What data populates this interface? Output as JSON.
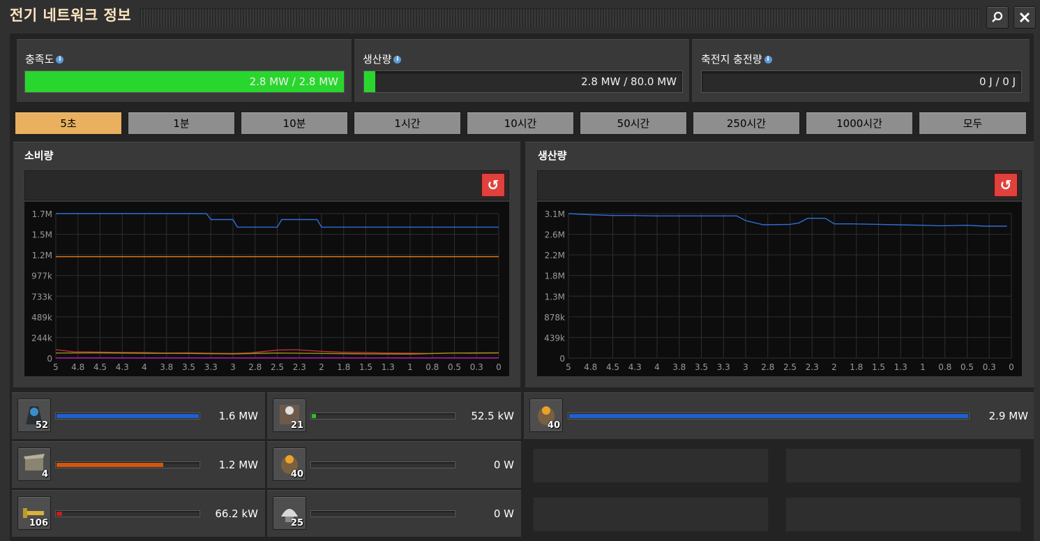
{
  "window": {
    "title": "전기 네트워크 정보",
    "search_icon": "magnifier-icon",
    "close_icon": "close-icon"
  },
  "stats": {
    "satisfaction": {
      "label": "충족도",
      "value_text": "2.8 MW / 2.8 MW",
      "fill_fraction": 1.0,
      "color": "#29d62e"
    },
    "production": {
      "label": "생산량",
      "value_text": "2.8 MW / 80.0 MW",
      "fill_fraction": 0.035,
      "color": "#29d62e"
    },
    "accumulator": {
      "label": "축전지 충전량",
      "value_text": "0 J / 0 J",
      "fill_fraction": 0
    }
  },
  "tabs": [
    {
      "label": "5초",
      "active": true
    },
    {
      "label": "1분",
      "active": false
    },
    {
      "label": "10분",
      "active": false
    },
    {
      "label": "1시간",
      "active": false
    },
    {
      "label": "10시간",
      "active": false
    },
    {
      "label": "50시간",
      "active": false
    },
    {
      "label": "250시간",
      "active": false
    },
    {
      "label": "1000시간",
      "active": false
    },
    {
      "label": "모두",
      "active": false
    }
  ],
  "chart_data": [
    {
      "type": "line",
      "title": "소비량",
      "grid": true,
      "xlim": [
        5,
        0
      ],
      "x_ticks": [
        "5",
        "4.8",
        "4.5",
        "4.3",
        "4",
        "3.8",
        "3.5",
        "3.3",
        "3",
        "2.8",
        "2.5",
        "2.3",
        "2",
        "1.8",
        "1.5",
        "1.3",
        "1",
        "0.8",
        "0.5",
        "0.3",
        "0"
      ],
      "y_ticks": [
        "1.7M",
        "1.5M",
        "1.2M",
        "977k",
        "733k",
        "489k",
        "244k",
        "0"
      ],
      "ylim": [
        0,
        1710000
      ],
      "series": [
        {
          "color": "#2f6fd8",
          "x": [
            5,
            3.3,
            3.25,
            3,
            2.95,
            2.5,
            2.45,
            2.05,
            2,
            0
          ],
          "y": [
            1710000,
            1710000,
            1640000,
            1640000,
            1550000,
            1550000,
            1640000,
            1640000,
            1550000,
            1550000
          ]
        },
        {
          "color": "#e07b1c",
          "x": [
            5,
            0
          ],
          "y": [
            1200000,
            1200000
          ]
        },
        {
          "color": "#c23030",
          "x": [
            5,
            4.8,
            4.5,
            4.3,
            4,
            3.8,
            3.5,
            3.3,
            3,
            2.8,
            2.5,
            2.3,
            2,
            1.8,
            1.5,
            1.3,
            1,
            0.8,
            0.5,
            0.3,
            0
          ],
          "y": [
            100000,
            75000,
            70000,
            68000,
            65000,
            60000,
            62000,
            58000,
            55000,
            62000,
            95000,
            100000,
            80000,
            70000,
            65000,
            60000,
            58000,
            55000,
            60000,
            58000,
            60000
          ]
        },
        {
          "color": "#a09020",
          "x": [
            5,
            4.5,
            4,
            3.5,
            3,
            2.5,
            2,
            1.5,
            1,
            0.5,
            0
          ],
          "y": [
            60000,
            62000,
            58000,
            55000,
            50000,
            60000,
            55000,
            50000,
            48000,
            60000,
            62000
          ]
        },
        {
          "color": "#c020c0",
          "x": [
            5,
            0
          ],
          "y": [
            2000,
            2000
          ]
        }
      ]
    },
    {
      "type": "line",
      "title": "생산량",
      "grid": true,
      "xlim": [
        5,
        0
      ],
      "x_ticks": [
        "5",
        "4.8",
        "4.5",
        "4.3",
        "4",
        "3.8",
        "3.5",
        "3.3",
        "3",
        "2.8",
        "2.5",
        "2.3",
        "2",
        "1.8",
        "1.5",
        "1.3",
        "1",
        "0.8",
        "0.5",
        "0.3",
        "0"
      ],
      "y_ticks": [
        "3.1M",
        "2.6M",
        "2.2M",
        "1.8M",
        "1.3M",
        "878k",
        "439k",
        "0"
      ],
      "ylim": [
        0,
        3100000
      ],
      "series": [
        {
          "color": "#2f6fd8",
          "x": [
            5,
            4.8,
            4.5,
            4.3,
            4,
            3.8,
            3.5,
            3.3,
            3.1,
            3.0,
            2.8,
            2.5,
            2.4,
            2.3,
            2.1,
            2.0,
            1.8,
            1.5,
            1.3,
            1,
            0.8,
            0.5,
            0.3,
            0.05
          ],
          "y": [
            3100000,
            3080000,
            3060000,
            3060000,
            3050000,
            3050000,
            3050000,
            3050000,
            3050000,
            2950000,
            2860000,
            2870000,
            2900000,
            3000000,
            3000000,
            2880000,
            2880000,
            2870000,
            2860000,
            2850000,
            2840000,
            2850000,
            2830000,
            2830000
          ]
        }
      ]
    }
  ],
  "consumers": [
    {
      "icon": "lab-icon",
      "count": "52",
      "value": "1.6 MW",
      "fraction": 1.0,
      "color": "#1f5fd0"
    },
    {
      "icon": "assembling-machine-icon",
      "count": "21",
      "value": "52.5 kW",
      "fraction": 0.03,
      "color": "#2bbf2b"
    },
    {
      "icon": "roboport-icon",
      "count": "4",
      "value": "1.2 MW",
      "fraction": 0.75,
      "color": "#d3560f"
    },
    {
      "icon": "steam-engine-icon",
      "count": "40",
      "value": "0 W",
      "fraction": 0,
      "color": "#1f5fd0"
    },
    {
      "icon": "inserter-icon",
      "count": "106",
      "value": "66.2 kW",
      "fraction": 0.04,
      "color": "#c02020"
    },
    {
      "icon": "radar-icon",
      "count": "25",
      "value": "0 W",
      "fraction": 0,
      "color": "#1f5fd0"
    }
  ],
  "producers": [
    {
      "icon": "steam-engine-icon",
      "count": "40",
      "value": "2.9 MW",
      "fraction": 1.0,
      "color": "#1f5fd0"
    }
  ]
}
